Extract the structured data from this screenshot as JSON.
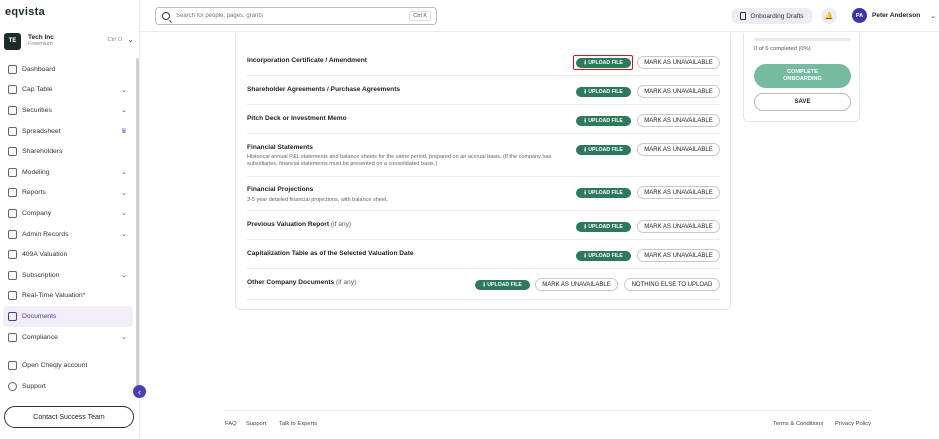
{
  "brand": {
    "logo": "eqvista"
  },
  "company": {
    "initials": "TE",
    "name": "Tech Inc",
    "plan": "Freemium",
    "shortcut": "Ctrl O"
  },
  "sidebar": {
    "items": [
      {
        "label": "Dashboard",
        "icon": "dashboard-icon",
        "chevron": false
      },
      {
        "label": "Cap Table",
        "icon": "cap-table-icon",
        "chevron": true
      },
      {
        "label": "Securities",
        "icon": "securities-icon",
        "chevron": true
      },
      {
        "label": "Spreadsheet",
        "icon": "spreadsheet-icon",
        "crown": true
      },
      {
        "label": "Shareholders",
        "icon": "shareholders-icon",
        "chevron": false
      },
      {
        "label": "Modeling",
        "icon": "modeling-icon",
        "chevron": true
      },
      {
        "label": "Reports",
        "icon": "reports-icon",
        "chevron": true
      },
      {
        "label": "Company",
        "icon": "company-icon",
        "chevron": true
      },
      {
        "label": "Admin Records",
        "icon": "admin-records-icon",
        "chevron": true
      },
      {
        "label": "409A Valuation",
        "icon": "valuation-icon",
        "chevron": false
      },
      {
        "label": "Subscription",
        "icon": "subscription-icon",
        "chevron": true
      },
      {
        "label": "Real-Time Valuation*",
        "icon": "realtime-chart-icon",
        "chevron": false
      },
      {
        "label": "Documents",
        "icon": "documents-icon",
        "active": true
      },
      {
        "label": "Compliance",
        "icon": "compliance-icon",
        "chevron": true
      }
    ],
    "bottom": [
      {
        "label": "Open Cheqly account",
        "icon": "cheqly-icon"
      },
      {
        "label": "Support",
        "icon": "help-icon"
      }
    ],
    "contact_label": "Contact Success Team",
    "collapse_icon": "‹"
  },
  "topbar": {
    "search_placeholder": "Search for people, pages, grants",
    "search_shortcut": "Ctrl K",
    "drafts_label": "Onboarding Drafts",
    "bell_icon": "🔔",
    "user_initials": "PA",
    "user_name": "Peter Anderson"
  },
  "documents": {
    "upload_label": "UPLOAD FILE",
    "unavailable_label": "MARK AS UNAVAILABLE",
    "nothing_else_label": "NOTHING ELSE TO UPLOAD",
    "rows": [
      {
        "title": "Incorporation Certificate / Amendment",
        "optional": "",
        "desc": ""
      },
      {
        "title": "Shareholder Agreements / Purchase Agreements",
        "optional": "",
        "desc": ""
      },
      {
        "title": "Pitch Deck or Investment Memo",
        "optional": "",
        "desc": ""
      },
      {
        "title": "Financial Statements",
        "optional": "",
        "desc": "Historical annual P&L statements and balance sheets for the same period, prepared on an accrual basis. (If the company has subsidiaries, financial statements must be presented on a consolidated basis.)"
      },
      {
        "title": "Financial Projections",
        "optional": "",
        "desc": "3-5 year detailed financial projections, with balance sheet."
      },
      {
        "title": "Previous Valuation Report",
        "optional": "(if any)",
        "desc": ""
      },
      {
        "title": "Capitalization Table as of the Selected Valuation Date",
        "optional": "",
        "desc": ""
      },
      {
        "title": "Other Company Documents",
        "optional": "(if any)",
        "desc": ""
      }
    ]
  },
  "progress": {
    "text": "0 of 6 completed (0%)",
    "fraction": 0,
    "complete_label": "COMPLETE ONBOARDING",
    "save_label": "SAVE"
  },
  "footer": {
    "links": [
      "FAQ",
      "Support",
      "Talk to Experts"
    ],
    "right_links": [
      "Terms & Conditions",
      "Privacy Policy"
    ]
  },
  "colors": {
    "accent": "#4b3fb0",
    "upload": "#2c7a5b",
    "complete": "#76bba0",
    "highlight": "#d0131b"
  }
}
